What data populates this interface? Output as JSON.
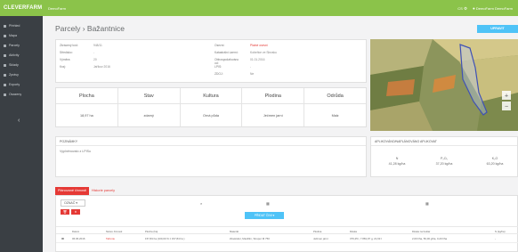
{
  "app": {
    "brand": "CLEVERFARM",
    "name": "DemoFarm",
    "lang": "CS",
    "user": "DemoFarm DemoFarm"
  },
  "sidebar": {
    "items": [
      "Přehled",
      "Mapa",
      "Parcely",
      "Aktivity",
      "Sklady",
      "Zprávy",
      "Exporty",
      "Osazeny"
    ]
  },
  "page": {
    "title": "Parcely › Bažantnice",
    "export_label": "UPRAVIT"
  },
  "info": {
    "left": [
      {
        "k": "Zkrácený kód:",
        "v": "948/11"
      },
      {
        "k": "Středisko:",
        "v": "-"
      },
      {
        "k": "Výměra:",
        "v": "20"
      },
      {
        "k": "Kraj:",
        "v": "Jaříkov 2016"
      }
    ],
    "right": [
      {
        "k": "Osevní:",
        "v": "Platné osevní"
      },
      {
        "k": "Katastrální území:",
        "v": "Kobeřice ve Slezsku"
      },
      {
        "k": "Obhospodařováno od:",
        "v": "01.01.2016"
      },
      {
        "k": "LPIS:",
        "v": "-"
      },
      {
        "k": "ZDOJ:",
        "v": "Ne"
      }
    ]
  },
  "summary": {
    "headers": [
      "Plocha",
      "Stav",
      "Kultura",
      "Plodina",
      "Odrůda"
    ],
    "values": [
      "18,97 ha",
      "zdarný",
      "Orná půda",
      "Ječmen jarní",
      "Malz"
    ]
  },
  "notes": {
    "title": "POZNÁMKY",
    "text": "Vyplněnovalo z LPISu"
  },
  "applied": {
    "title": "APLIKOVÁNO/NAPLÁNOVÁNO APLIKOVAT",
    "n": {
      "label": "N",
      "value": "41,28 kg/ha"
    },
    "p": {
      "label": "P₂O₅",
      "value": "37,20 kg/ha"
    },
    "k": {
      "label": "K₂O",
      "value": "63,20 kg/ha"
    }
  },
  "tabs": [
    "Plánované činnosti",
    "Historie parcely"
  ],
  "table": {
    "oznac_label": "OZNAČ ▾",
    "add_label": "PŘIDAT ČINI ▾",
    "headers": [
      "Datum",
      "Název činnosti",
      "Plocha (ha)",
      "Materiál",
      "Plodina",
      "Dávka",
      "Dávka na hektar",
      "N (kg/ha)"
    ],
    "row": [
      "06.06.2016",
      "Tažonie",
      "157,84 ha (100,00 % z 157,84 ha )",
      "Zinektofer, Maxifilm, Stroper M 750",
      "Ječmen jarní",
      "376,25 l, 7 881,97 g, 21,63 l",
      "2,00 l/ha, 50,00 g/ha, 0,20 l/ha",
      "-"
    ]
  }
}
